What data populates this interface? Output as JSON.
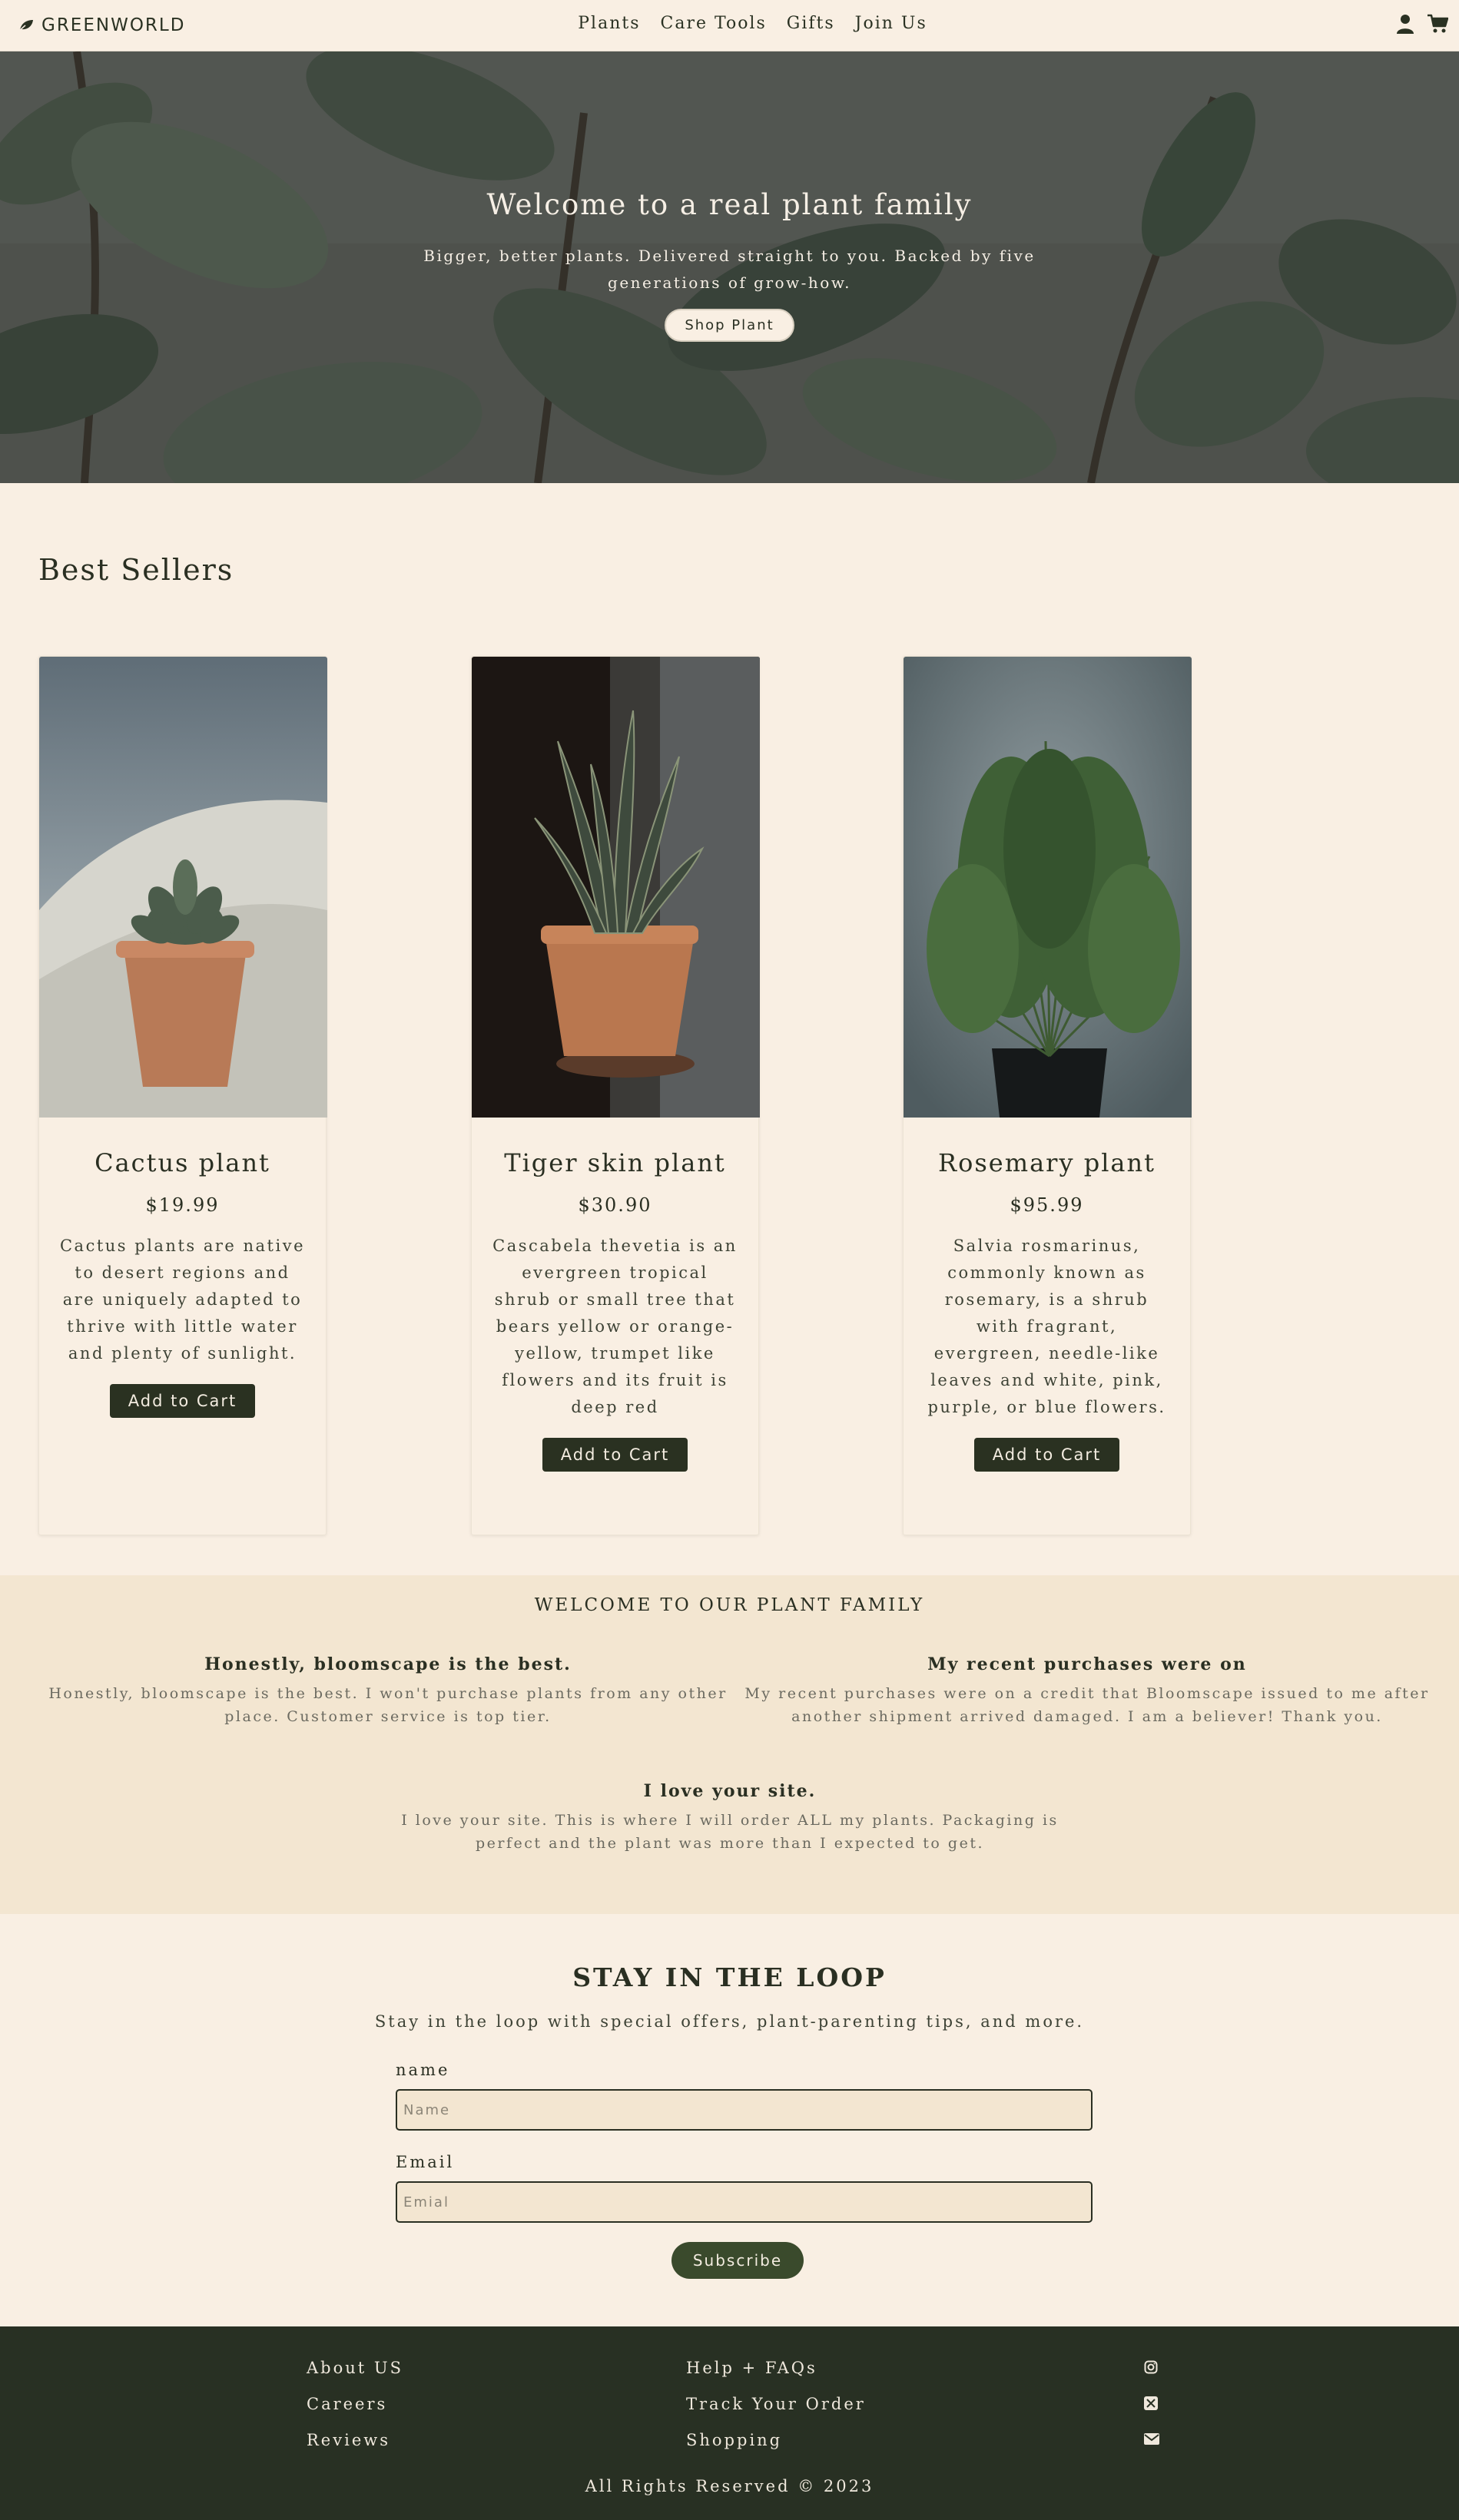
{
  "nav": {
    "brand": "GREENWORLD",
    "links": [
      "Plants",
      "Care Tools",
      "Gifts",
      "Join Us"
    ],
    "icons": [
      "leaf-icon",
      "user-icon",
      "cart-icon"
    ]
  },
  "hero": {
    "title": "Welcome to a real plant family",
    "subtitle": "Bigger, better plants. Delivered straight to you. Backed by five generations of grow-how.",
    "button": "Shop Plant"
  },
  "best_sellers": {
    "title": "Best Sellers",
    "products": [
      {
        "name": "Cactus plant",
        "price": "$19.99",
        "description": "Cactus plants are native to desert regions and are uniquely adapted to thrive with little water and plenty of sunlight.",
        "button": "Add to Cart"
      },
      {
        "name": "Tiger skin plant",
        "price": "$30.90",
        "description": "Cascabela thevetia is an evergreen tropical shrub or small tree that bears yellow or orange-yellow, trumpet like flowers and its fruit is deep red",
        "button": "Add to Cart"
      },
      {
        "name": "Rosemary plant",
        "price": "$95.99",
        "description": "Salvia rosmarinus, commonly known as rosemary, is a shrub with fragrant, evergreen, needle-like leaves and white, pink, purple, or blue flowers.",
        "button": "Add to Cart"
      }
    ]
  },
  "testimonials": {
    "heading": "WELCOME TO OUR PLANT FAMILY",
    "items": [
      {
        "title": "Honestly, bloomscape is the best.",
        "body": "Honestly, bloomscape is the best. I won't purchase plants from any other place. Customer service is top tier."
      },
      {
        "title": "My recent purchases were on",
        "body": "My recent purchases were on a credit that Bloomscape issued to me after another shipment arrived damaged. I am a believer! Thank you."
      },
      {
        "title": "I love your site.",
        "body": "I love your site. This is where I will order ALL my plants. Packaging is perfect and the plant was more than I expected to get."
      }
    ]
  },
  "newsletter": {
    "title": "STAY IN THE LOOP",
    "subtitle": "Stay in the loop with special offers, plant-parenting tips, and more.",
    "name_label": "name",
    "name_placeholder": "Name",
    "email_label": "Email",
    "email_placeholder": "Emial",
    "button": "Subscribe"
  },
  "footer": {
    "col1": [
      "About US",
      "Careers",
      "Reviews"
    ],
    "col2": [
      "Help + FAQs",
      "Track Your Order",
      "Shopping"
    ],
    "social_icons": [
      "instagram-icon",
      "x-icon",
      "mail-icon"
    ],
    "copyright": "All Rights Reserved © 2023"
  },
  "colors": {
    "background": "#f9efe3",
    "dark_green": "#283023",
    "testimonial_bg": "#f3e6d1",
    "subscribe_button": "#3a4a2c"
  }
}
